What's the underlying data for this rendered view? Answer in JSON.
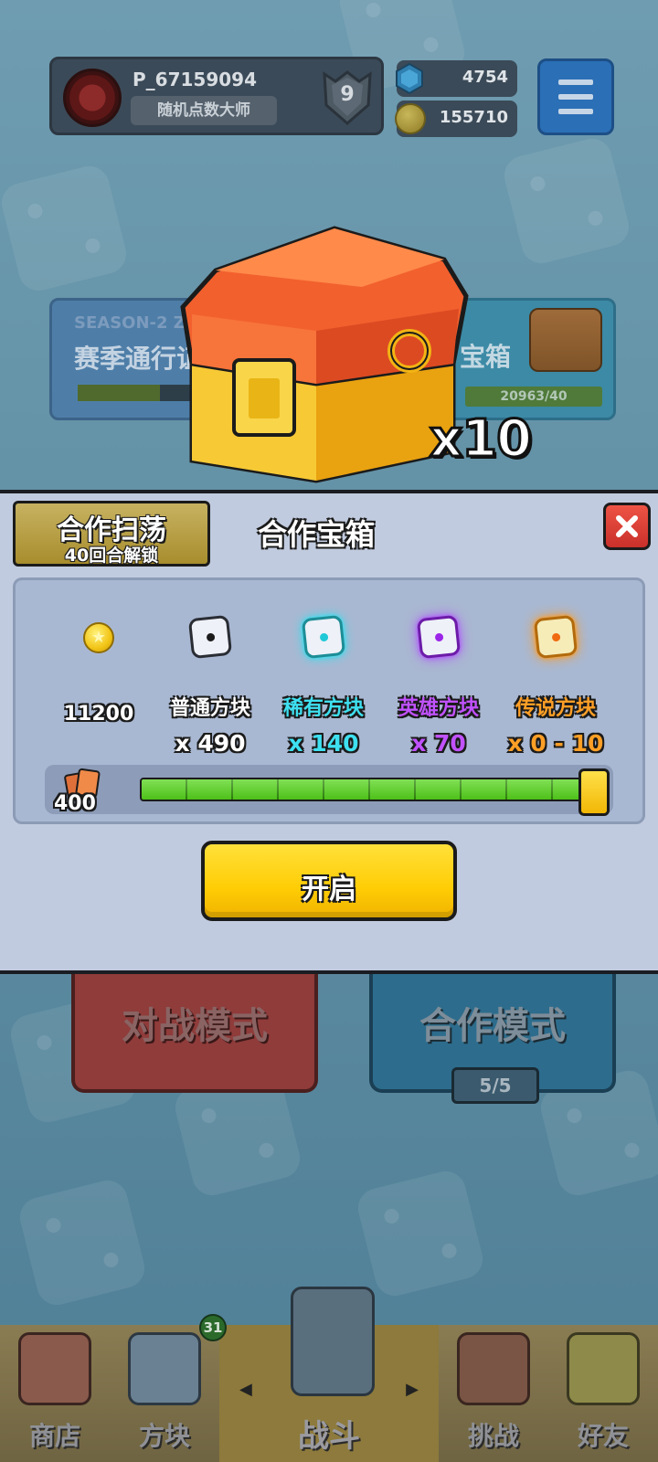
{
  "header": {
    "username": "P_67159094",
    "player_title": "随机点数大师",
    "level": "9",
    "gems": "4754",
    "gold": "155710"
  },
  "background": {
    "season_label": "SEASON-2 Z",
    "season_name": "赛季通行证",
    "chest_card_label": "宝箱",
    "chest_card_progress": "20963/40"
  },
  "chest": {
    "multiplier": "x10"
  },
  "modal": {
    "sweep_button_label": "合作扫荡",
    "sweep_unlock_text": "40回合解锁",
    "title": "合作宝箱",
    "rewards": {
      "gold_amount": "11200",
      "normal_label": "普通方块",
      "normal_qty": "x 490",
      "rare_label": "稀有方块",
      "rare_qty": "x 140",
      "hero_label": "英雄方块",
      "hero_qty": "x 70",
      "legend_label": "传说方块",
      "legend_qty": "x 0 - 10"
    },
    "cards_count": "400",
    "slider_level": 1.0,
    "open_button_label": "开启"
  },
  "modes": {
    "battle_label": "对战模式",
    "coop_label": "合作模式",
    "coop_count": "5/5"
  },
  "nav": {
    "shop": "商店",
    "dice": "方块",
    "dice_badge": "31",
    "battle": "战斗",
    "challenge": "挑战",
    "friends": "好友",
    "left_arrow": "◀",
    "right_arrow": "▶"
  },
  "colors": {
    "accent_yellow": "#ffcd05",
    "rare": "#3ee0f0",
    "hero": "#c152ff",
    "legend": "#ff9f26",
    "progress_green": "#56d61c"
  }
}
